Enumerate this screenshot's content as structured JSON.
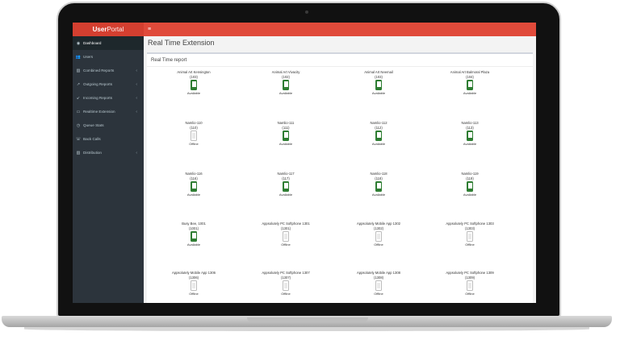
{
  "brand": {
    "name": "User",
    "suffix": "Portal"
  },
  "menu_icon": "≡",
  "sidebar": {
    "items": [
      {
        "label": "Dashboard",
        "icon": "dashboard-icon",
        "glyph": "◉",
        "active": true,
        "has_children": false
      },
      {
        "label": "Users",
        "icon": "users-icon",
        "glyph": "👥",
        "active": false,
        "has_children": false
      },
      {
        "label": "Combined Reports",
        "icon": "bar-chart-icon",
        "glyph": "▥",
        "active": false,
        "has_children": true
      },
      {
        "label": "Outgoing Reports",
        "icon": "outgoing-icon",
        "glyph": "↗",
        "active": false,
        "has_children": true
      },
      {
        "label": "Incoming Reports",
        "icon": "incoming-icon",
        "glyph": "↙",
        "active": false,
        "has_children": true
      },
      {
        "label": "Realtime Extension",
        "icon": "monitor-icon",
        "glyph": "▭",
        "active": false,
        "has_children": true
      },
      {
        "label": "Queue Stats",
        "icon": "clock-icon",
        "glyph": "◷",
        "active": false,
        "has_children": false
      },
      {
        "label": "Back Calls",
        "icon": "phone-icon",
        "glyph": "☏",
        "active": false,
        "has_children": false
      },
      {
        "label": "Distribution",
        "icon": "bar-chart-icon",
        "glyph": "▥",
        "active": false,
        "has_children": true
      }
    ]
  },
  "page": {
    "title": "Real Time Extension",
    "panel_title": "Real Time report"
  },
  "extensions": [
    {
      "name": "Animal Art Kensington",
      "number": "(103)",
      "status": "Available",
      "online": true
    },
    {
      "name": "Animal Art Vivacity",
      "number": "(102)",
      "status": "Available",
      "online": true
    },
    {
      "name": "Animal Art Neemail",
      "number": "(103)",
      "status": "Available",
      "online": true
    },
    {
      "name": "Animal Art Balmoral Plaza",
      "number": "(104)",
      "status": "Available",
      "online": true
    },
    {
      "name": "Namlio-110",
      "number": "(110)",
      "status": "Offline",
      "online": false
    },
    {
      "name": "Namlio-111",
      "number": "(111)",
      "status": "Available",
      "online": true
    },
    {
      "name": "Namlio-112",
      "number": "(112)",
      "status": "Available",
      "online": true
    },
    {
      "name": "Namlio-113",
      "number": "(113)",
      "status": "Available",
      "online": true
    },
    {
      "name": "Namlio-116",
      "number": "(116)",
      "status": "Available",
      "online": true
    },
    {
      "name": "Namlio-117",
      "number": "(117)",
      "status": "Available",
      "online": true
    },
    {
      "name": "Namlio-118",
      "number": "(118)",
      "status": "Available",
      "online": true
    },
    {
      "name": "Namlio-119",
      "number": "(119)",
      "status": "Available",
      "online": true
    },
    {
      "name": "Busy Bee, 1001",
      "number": "(1001)",
      "status": "Available",
      "online": true
    },
    {
      "name": "Appsolutely PC Softphone 1301",
      "number": "(1301)",
      "status": "Offline",
      "online": false
    },
    {
      "name": "Appsolutely Mobile App 1302",
      "number": "(1302)",
      "status": "Offline",
      "online": false
    },
    {
      "name": "Appsolutely PC Softphone 1303",
      "number": "(1303)",
      "status": "Offline",
      "online": false
    },
    {
      "name": "Appsolutely Mobile App 1306",
      "number": "(1306)",
      "status": "Offline",
      "online": false
    },
    {
      "name": "Appsolutely PC Softphone 1307",
      "number": "(1307)",
      "status": "Offline",
      "online": false
    },
    {
      "name": "Appsolutely Mobile App 1308",
      "number": "(1308)",
      "status": "Offline",
      "online": false
    },
    {
      "name": "Appsolutely PC Softphone 1309",
      "number": "(1309)",
      "status": "Offline",
      "online": false
    }
  ],
  "colors": {
    "header": "#e04a3a",
    "sidebar": "#2c343c",
    "available": "#2e7d32",
    "offline": "#bdbdbd"
  }
}
